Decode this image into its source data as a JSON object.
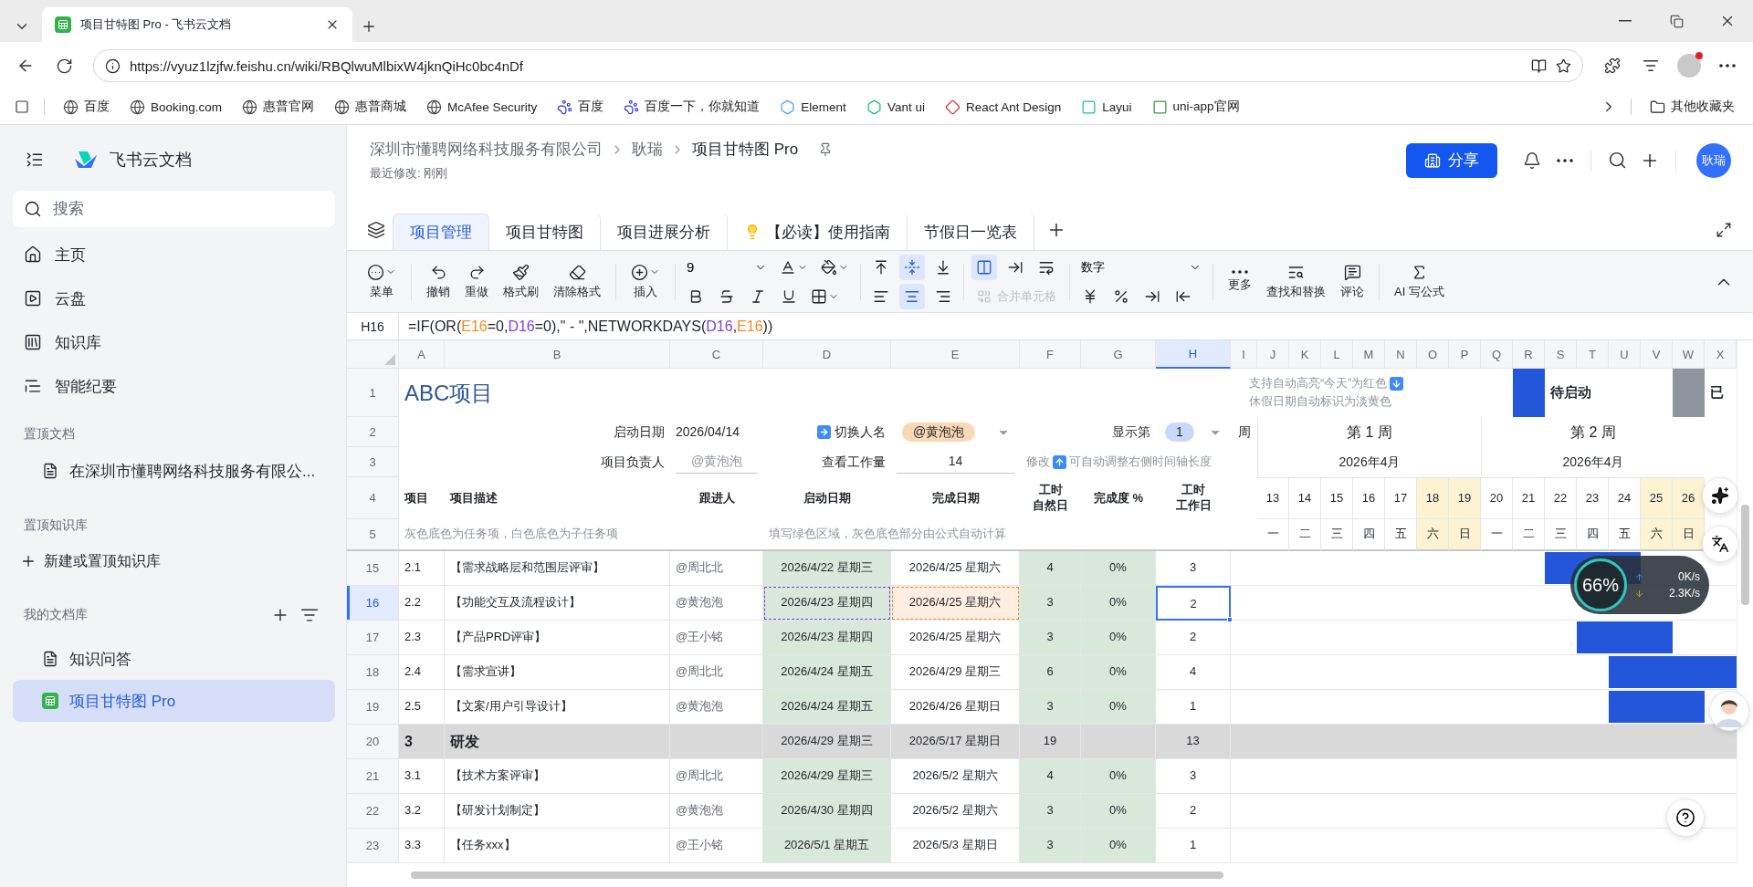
{
  "browser": {
    "tabs": [
      {
        "title": "项目甘特图 Pro - 飞书云文档",
        "selected": true
      }
    ],
    "url": "https://vyuz1lzjfw.feishu.cn/wiki/RBQlwuMlbixW4jknQiHc0bc4nDf",
    "bookmarks": [
      "百度",
      "Booking.com",
      "惠普官网",
      "惠普商城",
      "McAfee Security",
      "百度",
      "百度一下，你就知道",
      "Element",
      "Vant ui",
      "React Ant Design",
      "Layui",
      "uni-app官网"
    ],
    "other_bookmarks": "其他收藏夹"
  },
  "sidebar": {
    "brand": "飞书云文档",
    "search_placeholder": "搜索",
    "nav": [
      "主页",
      "云盘",
      "知识库",
      "智能纪要"
    ],
    "pinned_docs": {
      "title": "置顶文档",
      "items": [
        "在深圳市懂聘网络科技服务有限公..."
      ]
    },
    "pinned_wiki": {
      "title": "置顶知识库",
      "action": "新建或置顶知识库"
    },
    "library": {
      "title": "我的文档库",
      "items": [
        {
          "label": "知识问答",
          "kind": "doc",
          "selected": false
        },
        {
          "label": "项目甘特图 Pro",
          "kind": "sheet",
          "selected": true
        }
      ]
    }
  },
  "header": {
    "breadcrumb": [
      "深圳市懂聘网络科技服务有限公司",
      "耿瑞",
      "项目甘特图 Pro"
    ],
    "modified": "最近修改: 刚刚",
    "share": "分享",
    "avatar": "耿瑞"
  },
  "sheet_tabs": [
    {
      "label": "项目管理",
      "kind": "plain",
      "selected": true
    },
    {
      "label": "项目甘特图",
      "kind": "plain",
      "selected": false
    },
    {
      "label": "项目进展分析",
      "kind": "plain",
      "selected": false
    },
    {
      "label": "【必读】使用指南",
      "kind": "tip",
      "selected": false
    },
    {
      "label": "节假日一览表",
      "kind": "plain",
      "selected": false
    }
  ],
  "toolbar": {
    "buttons_left": [
      {
        "label": "菜单",
        "caret": true
      },
      {
        "label": "撤销",
        "caret": false
      },
      {
        "label": "重做",
        "caret": false
      },
      {
        "label": "格式刷",
        "caret": false
      },
      {
        "label": "清除格式",
        "caret": false
      },
      {
        "label": "插入",
        "caret": true
      }
    ],
    "font_size": "9",
    "valign": [
      {
        "selected": false
      },
      {
        "selected": true
      },
      {
        "selected": false
      }
    ],
    "wrap": [
      {
        "selected": true
      },
      {
        "selected": false
      },
      {
        "selected": false
      }
    ],
    "halign": [
      {
        "selected": false
      },
      {
        "selected": true
      },
      {
        "selected": false
      }
    ],
    "merge": {
      "label": "合并单元格",
      "disabled": true
    },
    "number_format": "数字",
    "buttons_right": [
      "更多",
      "查找和替换",
      "评论",
      "AI 写公式"
    ]
  },
  "formula": {
    "cell": "H16",
    "parts": [
      {
        "text": "=IF(OR("
      },
      {
        "text": "E16",
        "color": "#f5891d"
      },
      {
        "text": "=0,"
      },
      {
        "text": "D16",
        "color": "#7b3fe4"
      },
      {
        "text": "=0),\" - \",NETWORKDAYS("
      },
      {
        "text": "D16",
        "color": "#7b3fe4"
      },
      {
        "text": ","
      },
      {
        "text": "E16",
        "color": "#f5891d"
      },
      {
        "text": "))"
      }
    ]
  },
  "sheet": {
    "columns": [
      {
        "label": "A",
        "selected": false
      },
      {
        "label": "B",
        "selected": false
      },
      {
        "label": "C",
        "selected": false
      },
      {
        "label": "D",
        "selected": false
      },
      {
        "label": "E",
        "selected": false
      },
      {
        "label": "F",
        "selected": false
      },
      {
        "label": "G",
        "selected": false
      },
      {
        "label": "H",
        "selected": true
      },
      {
        "label": "I",
        "selected": false
      },
      {
        "label": "J",
        "selected": false
      },
      {
        "label": "K",
        "selected": false
      },
      {
        "label": "L",
        "selected": false
      },
      {
        "label": "M",
        "selected": false
      },
      {
        "label": "N",
        "selected": false
      },
      {
        "label": "O",
        "selected": false
      },
      {
        "label": "P",
        "selected": false
      },
      {
        "label": "Q",
        "selected": false
      },
      {
        "label": "R",
        "selected": false
      },
      {
        "label": "S",
        "selected": false
      },
      {
        "label": "T",
        "selected": false
      },
      {
        "label": "U",
        "selected": false
      },
      {
        "label": "V",
        "selected": false
      },
      {
        "label": "W",
        "selected": false
      },
      {
        "label": "X",
        "selected": false
      }
    ],
    "top_row_numbers": [
      "1",
      "2",
      "3",
      "4",
      "5"
    ],
    "title": "ABC项目",
    "notes": [
      "支持自动高亮“今天”为红色",
      "休假日期自动标识为淡黄色"
    ],
    "legend": [
      {
        "label": "待启动",
        "color": "#2456d9"
      },
      {
        "label": "已",
        "color": "#8f959e"
      }
    ],
    "start_label": "启动日期",
    "start_value": "2026/04/14",
    "switch_label": "切换人名",
    "switch_value": "@黄泡泡",
    "week_label": "显示第",
    "week_value": "1",
    "week_unit": "周",
    "owner_label": "项目负责人",
    "owner_value": "@黄泡泡",
    "workload_label": "查看工作量",
    "workload_value": "14",
    "adjust_prefix": "修改",
    "adjust_text": "可自动调整右侧时间轴长度",
    "weeks": [
      {
        "label": "第 1 周",
        "month": "2026年4月"
      },
      {
        "label": "第 2 周",
        "month": "2026年4月"
      }
    ],
    "headers": [
      {
        "label": "项目",
        "kind": "plain"
      },
      {
        "label": "项目描述",
        "kind": "plain"
      },
      {
        "label": "跟进人",
        "kind": "plain"
      },
      {
        "label": "启动日期",
        "kind": "plain"
      },
      {
        "label": "完成日期",
        "kind": "plain"
      },
      {
        "label": "工时自然日",
        "kind": "stacked"
      },
      {
        "label": "完成度 %",
        "kind": "plain"
      },
      {
        "label": "工时工作日",
        "kind": "stacked"
      }
    ],
    "hints": [
      "灰色底色为任务项，白色底色为子任务项",
      "填写绿色区域，灰色底色部分由公式自动计算"
    ],
    "days": [
      {
        "date": "13",
        "weekday": "一",
        "holiday": false
      },
      {
        "date": "14",
        "weekday": "二",
        "holiday": false
      },
      {
        "date": "15",
        "weekday": "三",
        "holiday": false
      },
      {
        "date": "16",
        "weekday": "四",
        "holiday": false
      },
      {
        "date": "17",
        "weekday": "五",
        "holiday": false
      },
      {
        "date": "18",
        "weekday": "六",
        "holiday": true
      },
      {
        "date": "19",
        "weekday": "日",
        "holiday": true
      },
      {
        "date": "20",
        "weekday": "一",
        "holiday": false
      },
      {
        "date": "21",
        "weekday": "二",
        "holiday": false
      },
      {
        "date": "22",
        "weekday": "三",
        "holiday": false
      },
      {
        "date": "23",
        "weekday": "四",
        "holiday": false
      },
      {
        "date": "24",
        "weekday": "五",
        "holiday": false
      },
      {
        "date": "25",
        "weekday": "六",
        "holiday": true
      },
      {
        "date": "26",
        "weekday": "日",
        "holiday": true
      }
    ],
    "rows": [
      {
        "num": "15",
        "kind": "task",
        "selected": false,
        "referenced": false,
        "id": "2.1",
        "desc": "【需求战略层和范围层评审】",
        "owner": "@周北北",
        "start": "2026/4/22 星期三",
        "end": "2026/4/25 星期六",
        "days": "4",
        "pct": "0%",
        "workdays": "3",
        "gantt": [
          false,
          false,
          false,
          false,
          false,
          false,
          false,
          false,
          false,
          true,
          true,
          true,
          false,
          false
        ],
        "bar_continues": false
      },
      {
        "num": "16",
        "kind": "task",
        "selected": true,
        "referenced": true,
        "id": "2.2",
        "desc": "【功能交互及流程设计】",
        "owner": "@黄泡泡",
        "start": "2026/4/23 星期四",
        "end": "2026/4/25 星期六",
        "days": "3",
        "pct": "0%",
        "workdays": "2",
        "gantt": [
          false,
          false,
          false,
          false,
          false,
          false,
          false,
          false,
          false,
          false,
          false,
          false,
          false,
          false
        ],
        "bar_continues": false
      },
      {
        "num": "17",
        "kind": "task",
        "selected": false,
        "referenced": false,
        "id": "2.3",
        "desc": "【产品PRD评审】",
        "owner": "@王小铭",
        "start": "2026/4/23 星期四",
        "end": "2026/4/25 星期六",
        "days": "3",
        "pct": "0%",
        "workdays": "2",
        "gantt": [
          false,
          false,
          false,
          false,
          false,
          false,
          false,
          false,
          false,
          false,
          true,
          true,
          true,
          false
        ],
        "bar_continues": false
      },
      {
        "num": "18",
        "kind": "task",
        "selected": false,
        "referenced": false,
        "id": "2.4",
        "desc": "【需求宣讲】",
        "owner": "@周北北",
        "start": "2026/4/24 星期五",
        "end": "2026/4/29 星期三",
        "days": "6",
        "pct": "0%",
        "workdays": "4",
        "gantt": [
          false,
          false,
          false,
          false,
          false,
          false,
          false,
          false,
          false,
          false,
          false,
          true,
          true,
          true
        ],
        "bar_continues": true
      },
      {
        "num": "19",
        "kind": "task",
        "selected": false,
        "referenced": false,
        "id": "2.5",
        "desc": "【文案/用户引导设计】",
        "owner": "@黄泡泡",
        "start": "2026/4/24 星期五",
        "end": "2026/4/26 星期日",
        "days": "3",
        "pct": "0%",
        "workdays": "1",
        "gantt": [
          false,
          false,
          false,
          false,
          false,
          false,
          false,
          false,
          false,
          false,
          false,
          true,
          true,
          true
        ],
        "bar_continues": false
      },
      {
        "num": "20",
        "kind": "group",
        "selected": false,
        "referenced": false,
        "id": "3",
        "desc": "研发",
        "start": "2026/4/29 星期三",
        "end": "2026/5/17 星期日",
        "days": "19",
        "workdays": "13",
        "gantt": [
          false,
          false,
          false,
          false,
          false,
          false,
          false,
          false,
          false,
          false,
          false,
          false,
          false,
          false
        ],
        "bar_continues": false
      },
      {
        "num": "21",
        "kind": "task",
        "selected": false,
        "referenced": false,
        "id": "3.1",
        "desc": "【技术方案评审】",
        "owner": "@周北北",
        "start": "2026/4/29 星期三",
        "end": "2026/5/2 星期六",
        "days": "4",
        "pct": "0%",
        "workdays": "3",
        "gantt": [
          false,
          false,
          false,
          false,
          false,
          false,
          false,
          false,
          false,
          false,
          false,
          false,
          false,
          false
        ],
        "bar_continues": false
      },
      {
        "num": "22",
        "kind": "task",
        "selected": false,
        "referenced": false,
        "id": "3.2",
        "desc": "【研发计划制定】",
        "owner": "@黄泡泡",
        "start": "2026/4/30 星期四",
        "end": "2026/5/2 星期六",
        "days": "3",
        "pct": "0%",
        "workdays": "2",
        "gantt": [
          false,
          false,
          false,
          false,
          false,
          false,
          false,
          false,
          false,
          false,
          false,
          false,
          false,
          false
        ],
        "bar_continues": false
      },
      {
        "num": "23",
        "kind": "task",
        "selected": false,
        "referenced": false,
        "id": "3.3",
        "desc": "【任务xxx】",
        "owner": "@王小铭",
        "start": "2026/5/1 星期五",
        "end": "2026/5/3 星期日",
        "days": "3",
        "pct": "0%",
        "workdays": "1",
        "gantt": [
          false,
          false,
          false,
          false,
          false,
          false,
          false,
          false,
          false,
          false,
          false,
          false,
          false,
          false
        ],
        "bar_continues": false
      }
    ]
  },
  "net_monitor": {
    "load": "66%",
    "up": "0K/s",
    "down": "2.3K/s"
  }
}
